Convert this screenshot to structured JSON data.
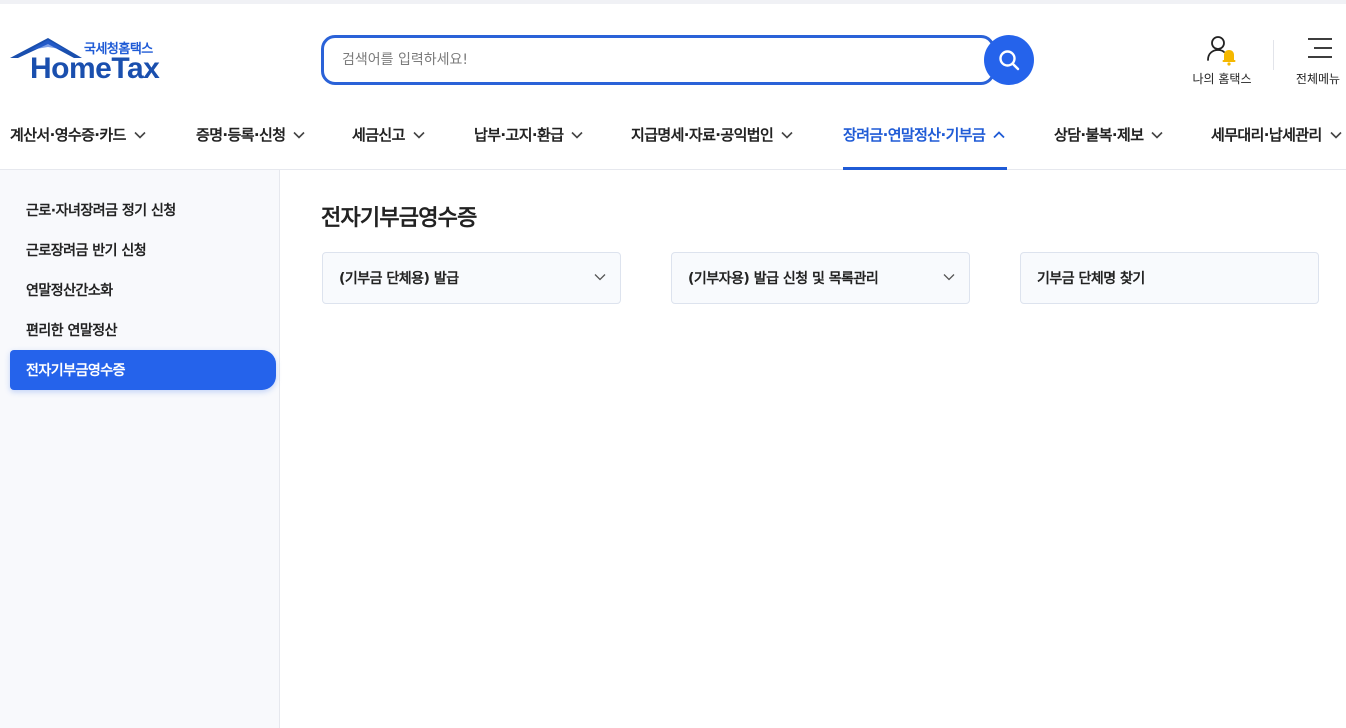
{
  "header": {
    "logo_sub": "국세청홈택스",
    "logo_main": "HomeTax",
    "search_placeholder": "검색어를 입력하세요!",
    "my_hometax_label": "나의 홈택스",
    "all_menu_label": "전체메뉴"
  },
  "nav": {
    "items": [
      {
        "label": "계산서·영수증·카드"
      },
      {
        "label": "증명·등록·신청"
      },
      {
        "label": "세금신고"
      },
      {
        "label": "납부·고지·환급"
      },
      {
        "label": "지급명세·자료·공익법인"
      },
      {
        "label": "장려금·연말정산·기부금",
        "active": true
      },
      {
        "label": "상담·불복·제보"
      },
      {
        "label": "세무대리·납세관리"
      }
    ]
  },
  "sidebar": {
    "items": [
      {
        "label": "근로·자녀장려금 정기 신청"
      },
      {
        "label": "근로장려금 반기 신청"
      },
      {
        "label": "연말정산간소화"
      },
      {
        "label": "편리한 연말정산"
      },
      {
        "label": "전자기부금영수증",
        "active": true
      }
    ]
  },
  "main": {
    "title": "전자기부금영수증",
    "cards": [
      {
        "label": "(기부금 단체용) 발급",
        "has_dropdown": true
      },
      {
        "label": "(기부자용) 발급 신청 및 목록관리",
        "has_dropdown": true
      },
      {
        "label": "기부금 단체명 찾기",
        "has_dropdown": false
      }
    ]
  },
  "colors": {
    "accent": "#2563eb",
    "brand": "#1a4fae",
    "active_nav": "#1f5bd6"
  },
  "icons": {
    "search": "search-icon",
    "my_hometax": "user-bell-icon",
    "all_menu": "hamburger-icon",
    "chevron": "chevron-down-icon"
  }
}
